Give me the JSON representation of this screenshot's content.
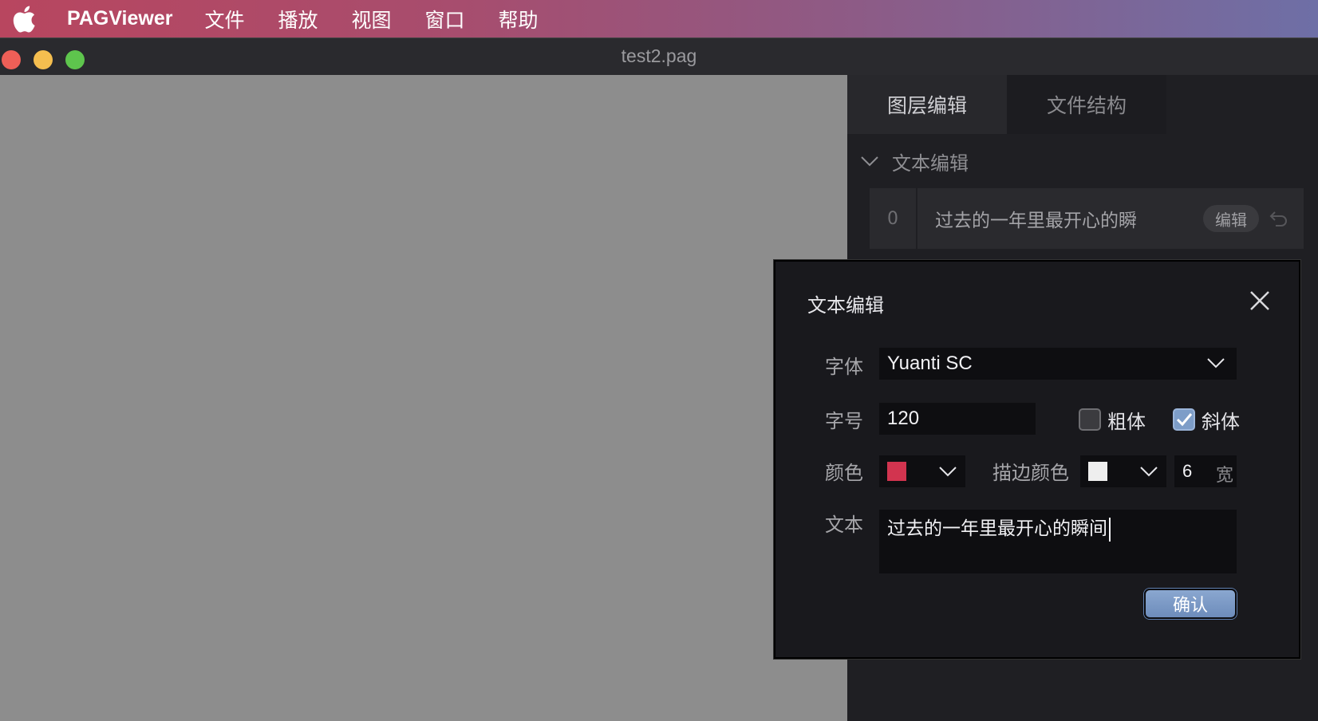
{
  "menubar": {
    "app_name": "PAGViewer",
    "items": [
      "文件",
      "播放",
      "视图",
      "窗口",
      "帮助"
    ]
  },
  "window": {
    "title": "test2.pag"
  },
  "right_panel": {
    "tabs": [
      {
        "label": "图层编辑",
        "active": true
      },
      {
        "label": "文件结构",
        "active": false
      }
    ],
    "section_title": "文本编辑",
    "text_rows": [
      {
        "index": "0",
        "text": "过去的一年里最开心的瞬",
        "edit_label": "编辑"
      }
    ]
  },
  "dialog": {
    "title": "文本编辑",
    "font_label": "字体",
    "font_value": "Yuanti SC",
    "size_label": "字号",
    "size_value": "120",
    "bold_label": "粗体",
    "bold_checked": false,
    "italic_label": "斜体",
    "italic_checked": true,
    "color_label": "颜色",
    "text_color": "#d2344f",
    "stroke_label": "描边颜色",
    "stroke_color": "#eeeeee",
    "stroke_width": "6",
    "stroke_width_unit": "宽",
    "text_label": "文本",
    "text_value": "过去的一年里最开心的瞬间",
    "confirm_label": "确认"
  },
  "colors": {
    "menubar_start": "#b8465f",
    "menubar_end": "#6e6fa6",
    "preview_bg": "#8d8d8d",
    "accent_button": "#7d9dc8"
  }
}
